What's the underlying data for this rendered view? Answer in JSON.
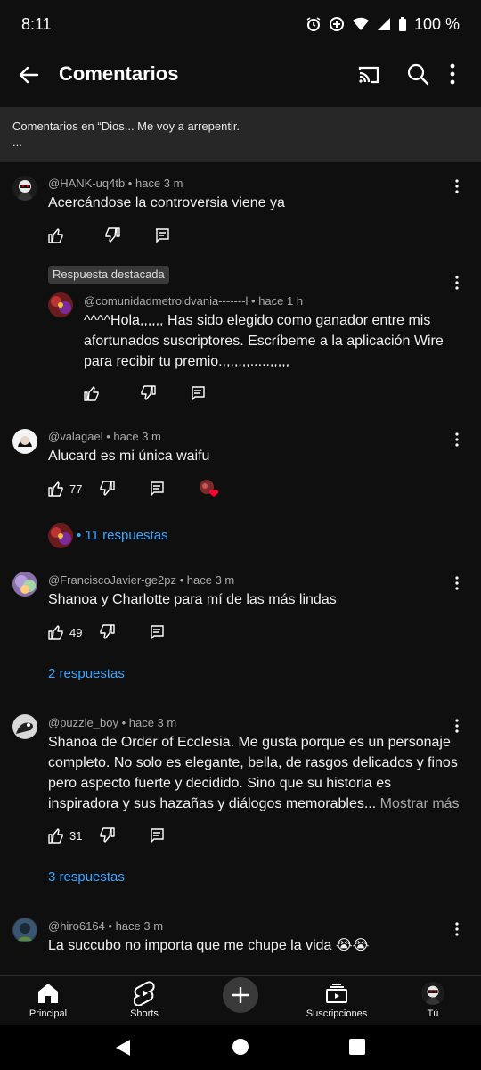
{
  "status": {
    "time": "8:11",
    "battery": "100 %"
  },
  "header": {
    "title": "Comentarios"
  },
  "context_line": "Comentarios en “Dios... Me voy a arrepentir.",
  "context_ellipsis": "...",
  "comments": [
    {
      "author": "@HANK-uq4tb",
      "time": "hace 3 m",
      "text": "Acercándose la controversia viene ya",
      "likes": ""
    },
    {
      "author": "@valagael",
      "time": "hace 3 m",
      "text": "Alucard es mi única waifu",
      "likes": "77",
      "replies": "• 11 respuestas"
    },
    {
      "author": "@FranciscoJavier-ge2pz",
      "time": "hace 3 m",
      "text": "Shanoa y Charlotte para mí de las más lindas",
      "likes": "49",
      "replies": "2 respuestas"
    },
    {
      "author": "@puzzle_boy",
      "time": "hace 3 m",
      "text_lines": [
        "Shanoa de Order of Ecclesia. Me gusta porque es un personaje",
        "completo. No solo es elegante, bella, de rasgos delicados y finos",
        "pero aspecto fuerte y decidido. Sino que su historia es",
        "inspiradora y sus hazañas y diálogos memorables..."
      ],
      "more": "Mostrar más",
      "likes": "31",
      "replies": "3 respuestas"
    },
    {
      "author": "@hiro6164",
      "time": "hace 3 m",
      "text": "La succubo no importa que me chupe la vida 😭😭"
    }
  ],
  "pinned_reply": {
    "badge": "Respuesta destacada",
    "author": "@comunidadmetroidvania-------l",
    "time": "hace 1 h",
    "text_lines": [
      "^^^^Hola,,,,,, Has sido elegido como ganador entre mis",
      "afortunados suscriptores. Escríbeme a la aplicación Wire",
      "para recibir tu premio.,,,,,,,.....,,,,,"
    ]
  },
  "nav": [
    {
      "label": "Principal"
    },
    {
      "label": "Shorts"
    },
    {
      "label": ""
    },
    {
      "label": "Suscripciones"
    },
    {
      "label": "Tú"
    }
  ],
  "colors": {
    "background": "#0f0f0f",
    "link": "#3ea6ff",
    "meta": "#aaaaaa",
    "heart": "#ff0033"
  }
}
